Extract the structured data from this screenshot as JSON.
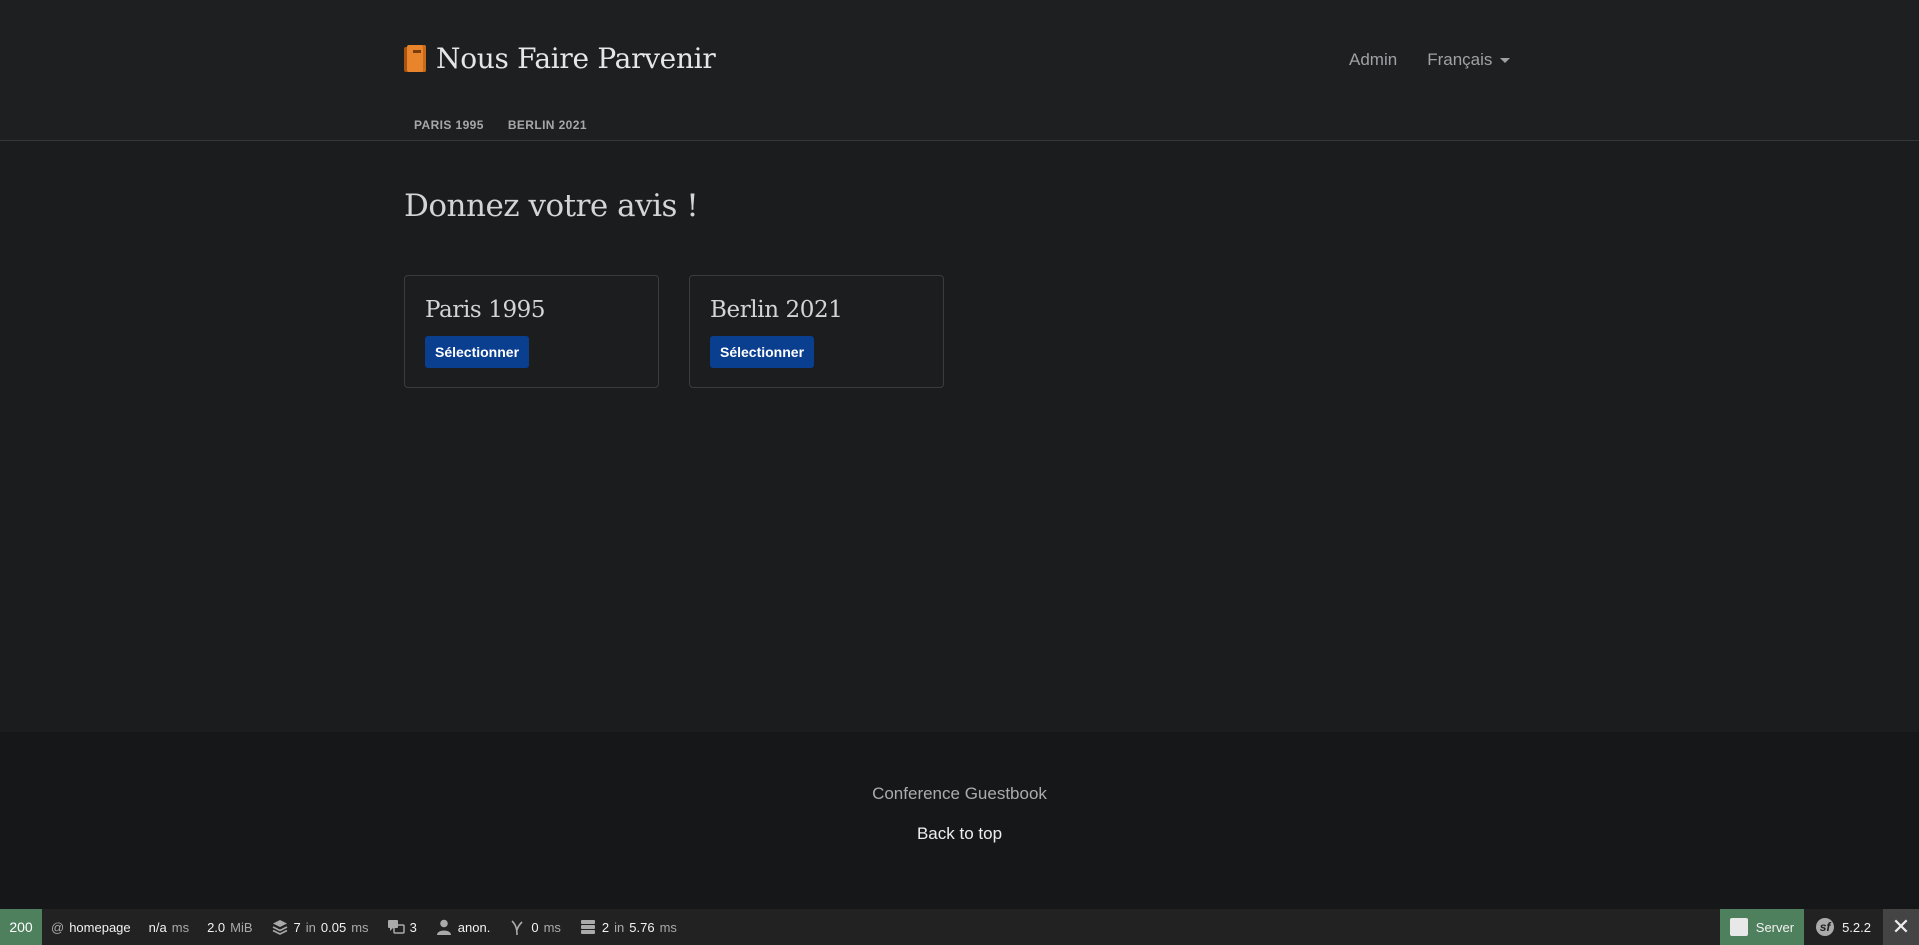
{
  "header": {
    "brand": "Nous Faire Parvenir",
    "brand_icon": "book-icon",
    "nav": {
      "admin": "Admin",
      "language": "Français"
    },
    "subnav": [
      "PARIS 1995",
      "BERLIN 2021"
    ]
  },
  "main": {
    "title": "Donnez votre avis !",
    "cards": [
      {
        "title": "Paris 1995",
        "button": "Sélectionner"
      },
      {
        "title": "Berlin 2021",
        "button": "Sélectionner"
      }
    ]
  },
  "footer": {
    "brand": "Conference Guestbook",
    "back_to_top": "Back to top"
  },
  "toolbar": {
    "status": "200",
    "route_at": "@",
    "route": "homepage",
    "time_value": "n/a",
    "time_unit": "ms",
    "memory_value": "2.0",
    "memory_unit": "MiB",
    "db_count": "7",
    "db_in": "in",
    "db_time": "0.05",
    "db_unit": "ms",
    "translation_count": "3",
    "user": "anon.",
    "twig_time": "0",
    "twig_unit": "ms",
    "cache_count": "2",
    "cache_in": "in",
    "cache_time": "5.76",
    "cache_unit": "ms",
    "server_label": "Server",
    "symfony_version": "5.2.2",
    "colors": {
      "status_ok": "#4f805d",
      "bar": "#222222"
    }
  },
  "colors": {
    "background": "#1a1c1d",
    "header": "#1e1f21",
    "button": "#0a3e8f",
    "footer": "#161718"
  }
}
